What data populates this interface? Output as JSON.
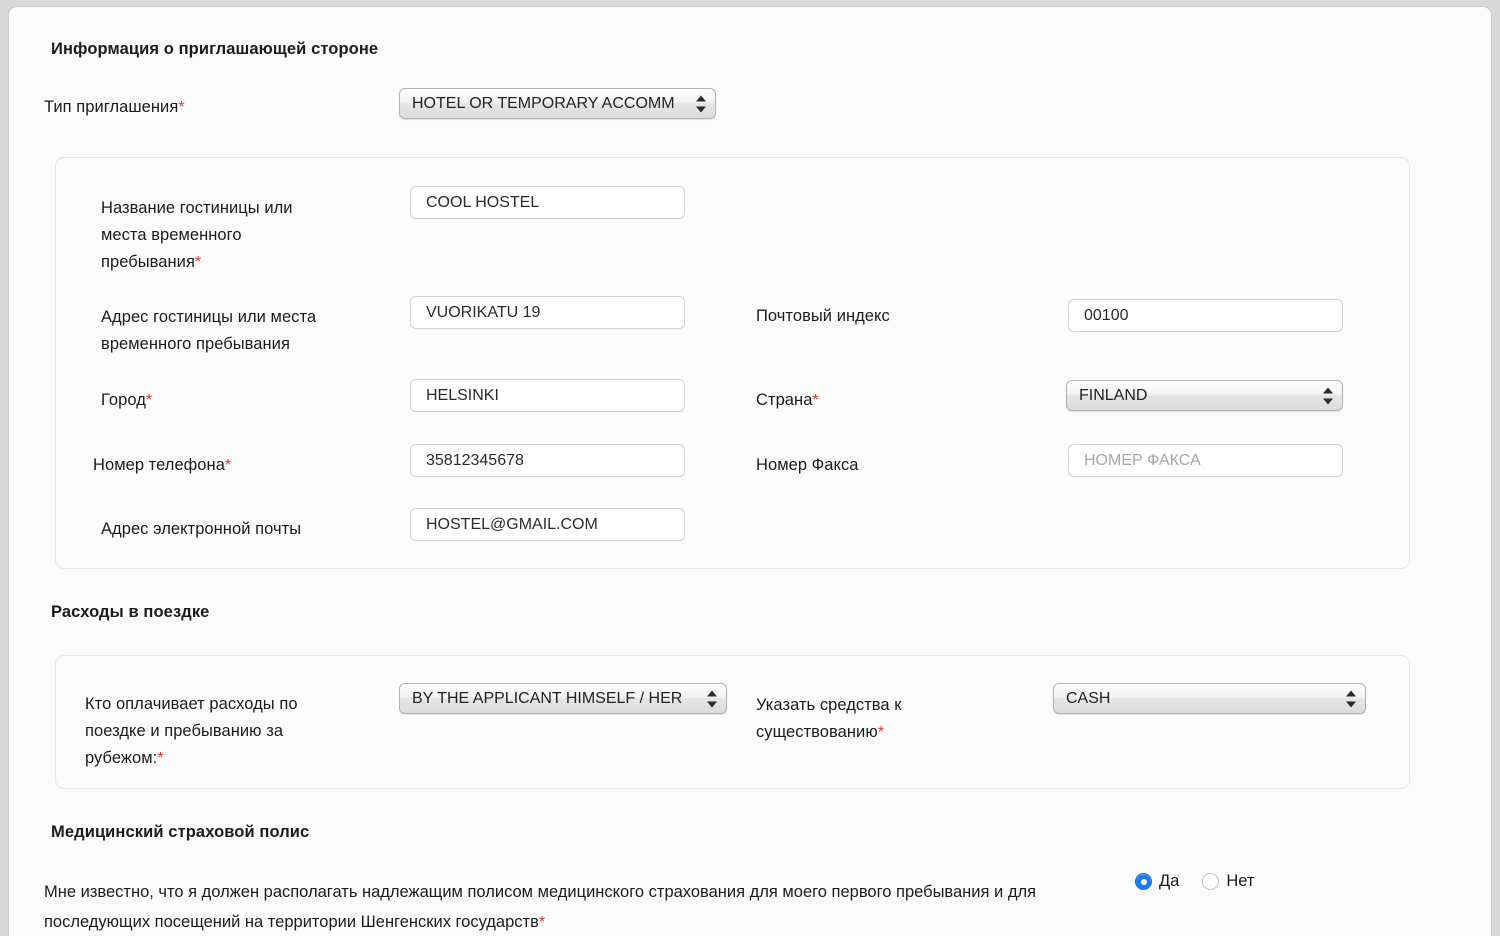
{
  "sections": {
    "inviting_party": {
      "title": "Информация о приглашающей стороне",
      "invitation_type": {
        "label": "Тип приглашения",
        "required": "*",
        "value": "HOTEL OR TEMPORARY ACCOMM"
      },
      "hotel_name": {
        "label_line1": "Название гостиницы или",
        "label_line2": "места временного",
        "label_line3": "пребывания",
        "required": "*",
        "value": "COOL HOSTEL"
      },
      "hotel_address": {
        "label_line1": "Адрес гостиницы или места",
        "label_line2": "временного пребывания",
        "value": "VUORIKATU 19"
      },
      "postal_code": {
        "label": "Почтовый индекс",
        "value": "00100"
      },
      "city": {
        "label": "Город",
        "required": "*",
        "value": "HELSINKI"
      },
      "country": {
        "label": "Страна",
        "required": "*",
        "value": "FINLAND"
      },
      "phone": {
        "label": "Номер телефона",
        "required": "*",
        "value": "35812345678"
      },
      "fax": {
        "label": "Номер Факса",
        "value": "",
        "placeholder": "НОМЕР ФАКСА"
      },
      "email": {
        "label": "Адрес электронной почты",
        "value": "HOSTEL@GMAIL.COM"
      }
    },
    "travel_expenses": {
      "title": "Расходы в поездке",
      "payer": {
        "label_line1": "Кто оплачивает расходы по",
        "label_line2": "поездке и пребыванию за",
        "label_line3": "рубежом:",
        "required": "*",
        "value": "BY THE APPLICANT HIMSELF / HER"
      },
      "means_of_support": {
        "label_line1": "Указать средства к",
        "label_line2": "существованию",
        "required": "*",
        "value": "CASH"
      }
    },
    "medical_insurance": {
      "title": "Медицинский страховой полис",
      "statement_line1": "Мне известно, что я должен располагать надлежащим полисом медицинского страхования для моего первого",
      "statement_line2": "пребывания и для последующих посещений на территории Шенгенских государств",
      "required": "*",
      "options": {
        "yes": "Да",
        "no": "Нет"
      },
      "selected": "yes"
    }
  },
  "colors": {
    "required_marker": "#e8342a",
    "radio_selected": "#1a7af0",
    "panel_border": "#ece3e5",
    "page_background": "#fbfbfb"
  }
}
